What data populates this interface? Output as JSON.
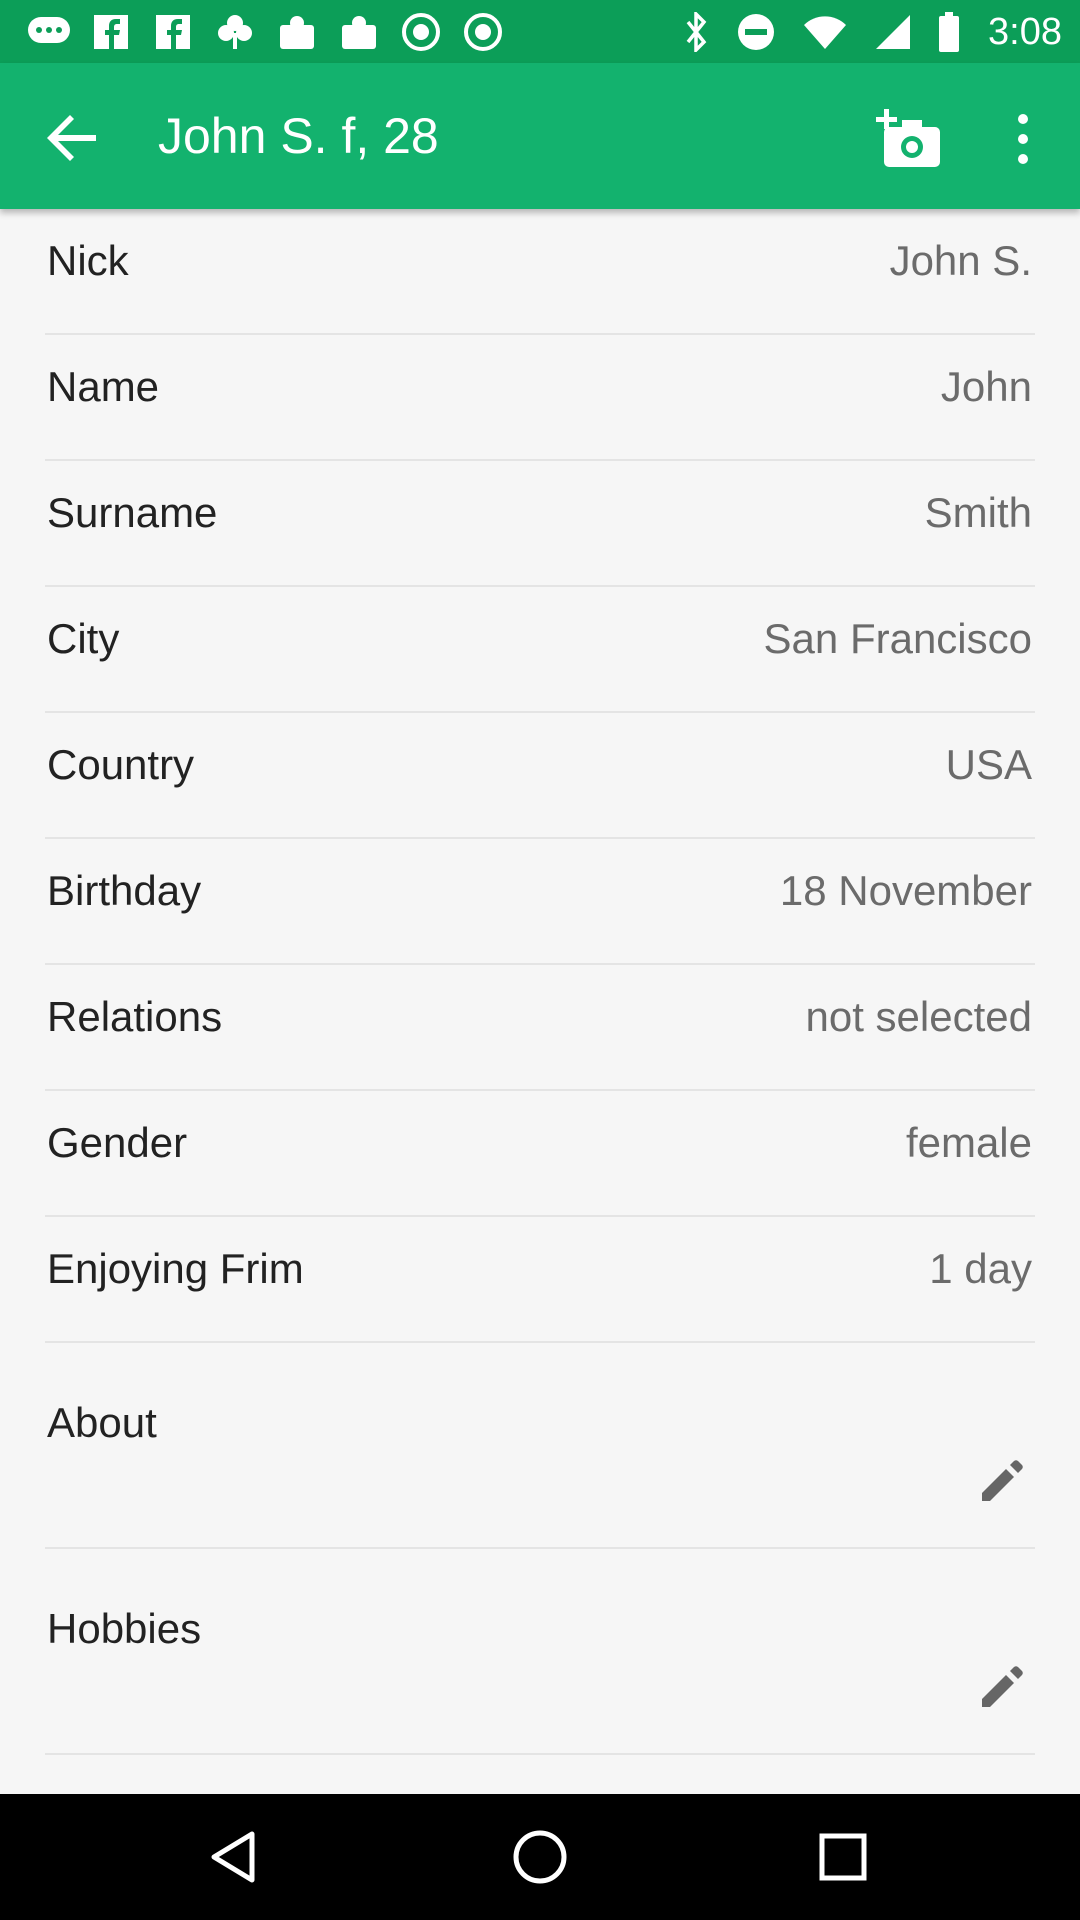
{
  "status_bar": {
    "time": "3:08",
    "icons": [
      "chat-icon",
      "fb-icon",
      "fb-icon",
      "clover-icon",
      "puzzle-icon",
      "puzzle-icon",
      "abc13-icon",
      "abc13-icon",
      "bluetooth-icon",
      "do-not-disturb-icon",
      "wifi-icon",
      "signal-icon",
      "battery-icon"
    ]
  },
  "app_bar": {
    "title": "John S. f, 28",
    "icons": [
      "back-arrow-icon",
      "add-photo-icon",
      "overflow-menu-icon"
    ],
    "color": "#13b26e"
  },
  "profile": {
    "rows": [
      {
        "label": "Nick",
        "value": "John S."
      },
      {
        "label": "Name",
        "value": "John"
      },
      {
        "label": "Surname",
        "value": "Smith"
      },
      {
        "label": "City",
        "value": "San Francisco"
      },
      {
        "label": "Country",
        "value": "USA"
      },
      {
        "label": "Birthday",
        "value": "18 November"
      },
      {
        "label": "Relations",
        "value": "not selected"
      },
      {
        "label": "Gender",
        "value": "female"
      },
      {
        "label": "Enjoying Frim",
        "value": "1 day"
      }
    ],
    "editable": [
      {
        "label": "About",
        "icon": "pencil-icon"
      },
      {
        "label": "Hobbies",
        "icon": "pencil-icon"
      }
    ]
  },
  "nav_bar": {
    "icons": [
      "back-triangle-icon",
      "home-circle-icon",
      "recents-square-icon"
    ]
  }
}
